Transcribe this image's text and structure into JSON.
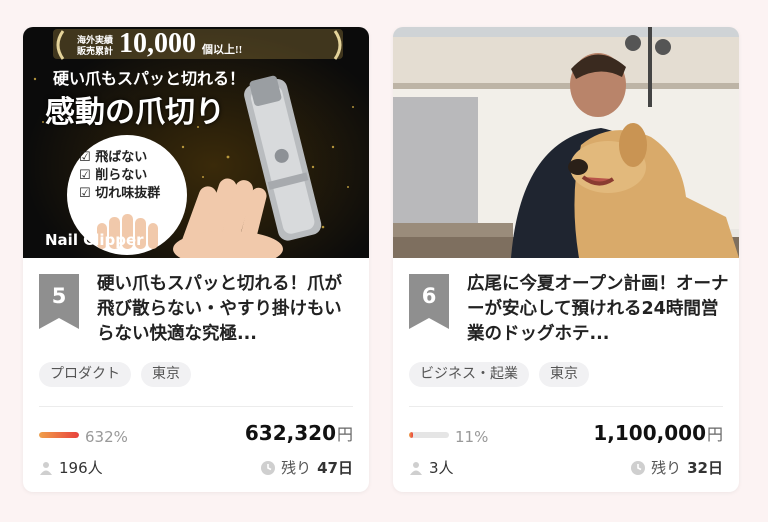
{
  "cards": [
    {
      "rank": "5",
      "banner": {
        "badge_small_1": "海外実績",
        "badge_small_2": "販売累計",
        "badge_number": "10,000",
        "badge_suffix": "個以上!!",
        "headline_1": "硬い爪もスパッと切れる！",
        "headline_2": "感動の爪切り",
        "checks": [
          "飛ばない",
          "削らない",
          "切れ味抜群"
        ],
        "product_label": "Nail Clipper"
      },
      "title": "硬い爪もスパッと切れる！爪が飛び散らない・やすり掛けもいらない快適な究極...",
      "tags": [
        "プロダクト",
        "東京"
      ],
      "progress_percent": 632,
      "percent_text": "632%",
      "amount": "632,320",
      "currency": "円",
      "supporters": "196人",
      "remaining_prefix": "残り",
      "remaining_days": "47日"
    },
    {
      "rank": "6",
      "title": "広尾に今夏オープン計画！オーナーが安心して預けれる24時間営業のドッグホテ...",
      "tags": [
        "ビジネス・起業",
        "東京"
      ],
      "progress_percent": 11,
      "percent_text": "11%",
      "amount": "1,100,000",
      "currency": "円",
      "supporters": "3人",
      "remaining_prefix": "残り",
      "remaining_days": "32日"
    }
  ],
  "colors": {
    "page_bg": "#fcf3f3",
    "rank_badge": "#8f8f8f",
    "progress_gradient_start": "#f0a04a",
    "progress_gradient_end": "#e8413d"
  }
}
